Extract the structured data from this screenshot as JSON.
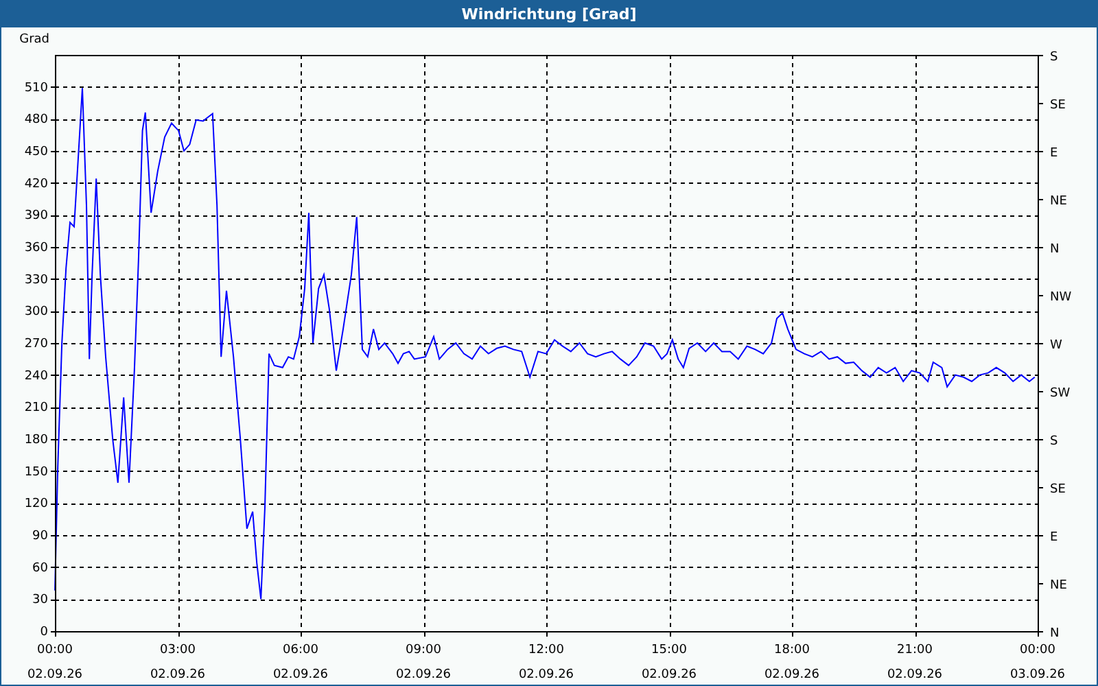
{
  "window": {
    "title": "Windrichtung [Grad]"
  },
  "chart": {
    "x_dates": [
      "02.09.26",
      "02.09.26",
      "02.09.26",
      "02.09.26",
      "02.09.26",
      "02.09.26",
      "02.09.26",
      "02.09.26",
      "03.09.26"
    ],
    "right_axis_labels": [
      "S",
      "SE",
      "E",
      "NE",
      "N",
      "NW",
      "W",
      "SW",
      "S",
      "SE",
      "E",
      "NE",
      "N"
    ],
    "chart_data": {
      "type": "line",
      "grid": true,
      "ylabel": "Grad",
      "xlim": [
        0,
        24
      ],
      "ylim": [
        0,
        540
      ],
      "xticks": [
        {
          "value": 0,
          "label": "00:00"
        },
        {
          "value": 3,
          "label": "03:00"
        },
        {
          "value": 6,
          "label": "06:00"
        },
        {
          "value": 9,
          "label": "09:00"
        },
        {
          "value": 12,
          "label": "12:00"
        },
        {
          "value": 15,
          "label": "15:00"
        },
        {
          "value": 18,
          "label": "18:00"
        },
        {
          "value": 21,
          "label": "21:00"
        },
        {
          "value": 24,
          "label": "00:00"
        }
      ],
      "yticks": [
        0,
        30,
        60,
        90,
        120,
        150,
        180,
        210,
        240,
        270,
        300,
        330,
        360,
        390,
        420,
        450,
        480,
        510
      ],
      "x": [
        0,
        0.07,
        0.17,
        0.27,
        0.37,
        0.47,
        0.6,
        0.67,
        0.77,
        0.84,
        0.91,
        1.01,
        1.11,
        1.24,
        1.41,
        1.54,
        1.68,
        1.81,
        1.94,
        2.04,
        2.14,
        2.21,
        2.35,
        2.51,
        2.68,
        2.85,
        3.02,
        3.15,
        3.29,
        3.45,
        3.62,
        3.75,
        3.85,
        3.96,
        4.06,
        4.19,
        4.36,
        4.53,
        4.69,
        4.83,
        4.93,
        5.03,
        5.13,
        5.23,
        5.36,
        5.56,
        5.7,
        5.83,
        5.97,
        6.1,
        6.2,
        6.3,
        6.44,
        6.57,
        6.7,
        6.87,
        7.04,
        7.24,
        7.37,
        7.51,
        7.64,
        7.78,
        7.91,
        8.05,
        8.25,
        8.38,
        8.51,
        8.65,
        8.78,
        9.05,
        9.25,
        9.39,
        9.59,
        9.79,
        9.99,
        10.19,
        10.39,
        10.59,
        10.79,
        10.99,
        11.2,
        11.4,
        11.6,
        11.8,
        12,
        12.2,
        12.4,
        12.6,
        12.81,
        13.01,
        13.21,
        13.41,
        13.61,
        13.81,
        14.01,
        14.21,
        14.41,
        14.62,
        14.82,
        14.95,
        15.08,
        15.22,
        15.35,
        15.49,
        15.69,
        15.89,
        16.09,
        16.29,
        16.49,
        16.69,
        16.9,
        17.1,
        17.3,
        17.5,
        17.63,
        17.77,
        17.9,
        18.1,
        18.3,
        18.5,
        18.71,
        18.91,
        19.11,
        19.31,
        19.51,
        19.71,
        19.91,
        20.11,
        20.31,
        20.52,
        20.72,
        20.92,
        21.12,
        21.32,
        21.45,
        21.66,
        21.79,
        21.99,
        22.19,
        22.39,
        22.59,
        22.79,
        22.99,
        23.2,
        23.4,
        23.6,
        23.8,
        23.93
      ],
      "series": [
        {
          "color": "#0000ff",
          "values": [
            38,
            154,
            270,
            340,
            383,
            379,
            463,
            509,
            399,
            255,
            334,
            424,
            334,
            257,
            180,
            139,
            219,
            139,
            244,
            347,
            469,
            486,
            392,
            431,
            463,
            476,
            469,
            450,
            456,
            479,
            478,
            482,
            485,
            399,
            257,
            319,
            257,
            180,
            96,
            112,
            64,
            30,
            116,
            260,
            249,
            247,
            257,
            255,
            276,
            321,
            392,
            270,
            321,
            334,
            302,
            244,
            283,
            334,
            388,
            264,
            257,
            283,
            264,
            270,
            260,
            251,
            260,
            262,
            255,
            257,
            276,
            255,
            264,
            270,
            260,
            255,
            267,
            260,
            265,
            267,
            264,
            262,
            238,
            262,
            260,
            273,
            267,
            262,
            270,
            260,
            257,
            260,
            262,
            255,
            249,
            257,
            270,
            267,
            255,
            260,
            273,
            255,
            247,
            265,
            270,
            262,
            270,
            262,
            262,
            255,
            267,
            264,
            260,
            270,
            293,
            298,
            283,
            264,
            260,
            257,
            262,
            255,
            257,
            251,
            252,
            244,
            238,
            247,
            242,
            247,
            234,
            244,
            242,
            234,
            252,
            247,
            229,
            240,
            238,
            234,
            240,
            242,
            247,
            242,
            234,
            240,
            234,
            238
          ]
        }
      ]
    }
  }
}
